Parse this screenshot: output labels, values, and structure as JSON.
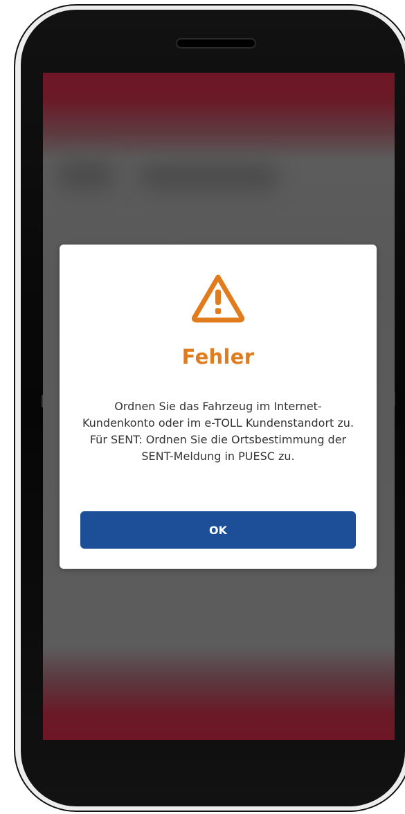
{
  "dialog": {
    "icon": "warning-triangle-icon",
    "title": "Fehler",
    "message": "Ordnen Sie das Fahrzeug im Internet-Kundenkonto oder im e-TOLL Kundenstandort zu. Für SENT: Ordnen Sie die Ortsbestimmung der SENT-Meldung in PUESC zu.",
    "ok_label": "OK"
  },
  "colors": {
    "accent": "#e07b1e",
    "button": "#1d4f99",
    "header_footer": "#6f1626",
    "overlay": "#5a5a5a"
  }
}
